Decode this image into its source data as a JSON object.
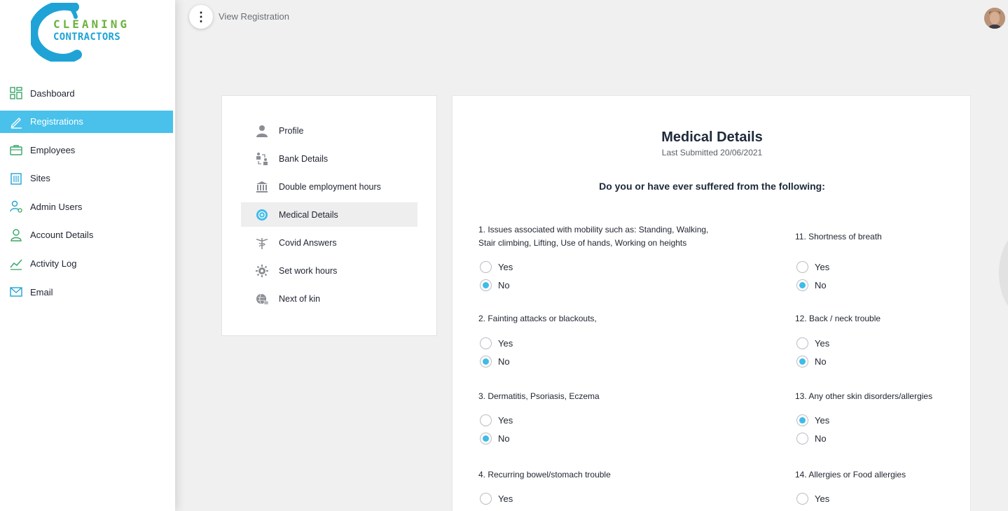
{
  "brand": {
    "line1": "CLEANING",
    "line2": "CONTRACTORS"
  },
  "sidebar": {
    "items": [
      {
        "label": "Dashboard",
        "icon": "dashboard-icon"
      },
      {
        "label": "Registrations",
        "icon": "pencil-icon"
      },
      {
        "label": "Employees",
        "icon": "briefcase-icon"
      },
      {
        "label": "Sites",
        "icon": "building-icon"
      },
      {
        "label": "Admin Users",
        "icon": "user-gear-icon"
      },
      {
        "label": "Account Details",
        "icon": "user-icon"
      },
      {
        "label": "Activity Log",
        "icon": "chart-line-icon"
      },
      {
        "label": "Email",
        "icon": "envelope-icon"
      }
    ],
    "active_index": 1
  },
  "topbar": {
    "breadcrumb": "View Registration"
  },
  "section_menu": {
    "items": [
      {
        "label": "Profile",
        "icon": "person-icon"
      },
      {
        "label": "Bank Details",
        "icon": "bank-transfer-icon"
      },
      {
        "label": "Double employment hours",
        "icon": "bank-building-icon"
      },
      {
        "label": "Medical Details",
        "icon": "medical-icon"
      },
      {
        "label": "Covid Answers",
        "icon": "caduceus-icon"
      },
      {
        "label": "Set work hours",
        "icon": "gear-icon"
      },
      {
        "label": "Next of kin",
        "icon": "globe-person-icon"
      }
    ],
    "active_index": 3
  },
  "medical": {
    "title": "Medical Details",
    "subtitle": "Last Submitted 20/06/2021",
    "question_head": "Do you or have ever suffered from the following:",
    "yes_label": "Yes",
    "no_label": "No",
    "left": [
      {
        "question": "1. Issues associated with mobility such as: Standing, Walking, Stair climbing, Lifting, Use of hands, Working on heights",
        "answer": "No"
      },
      {
        "question": "2. Fainting attacks or blackouts,",
        "answer": "No"
      },
      {
        "question": "3. Dermatitis, Psoriasis, Eczema",
        "answer": "No"
      },
      {
        "question": "4. Recurring bowel/stomach trouble",
        "answer": ""
      }
    ],
    "right": [
      {
        "question": "11. Shortness of breath",
        "answer": "No"
      },
      {
        "question": "12. Back / neck trouble",
        "answer": "No"
      },
      {
        "question": "13. Any other skin disorders/allergies",
        "answer": "Yes"
      },
      {
        "question": "14. Allergies or Food allergies",
        "answer": ""
      }
    ]
  },
  "colors": {
    "accent": "#49c1ea",
    "radio": "#3fbbea",
    "brand_green": "#6cb33f",
    "brand_blue": "#1fa3d6"
  }
}
